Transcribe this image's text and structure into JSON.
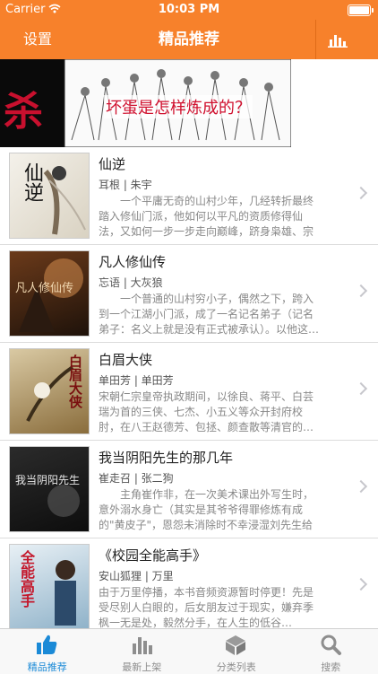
{
  "status_bar": {
    "carrier": "Carrier",
    "time": "10:03 PM"
  },
  "nav": {
    "settings_label": "设置",
    "title": "精品推荐"
  },
  "banner": {
    "caption": "坏蛋是怎样炼成的？",
    "overlay_text": "杀"
  },
  "books": [
    {
      "title": "仙逆",
      "author": "耳根 | 朱宇",
      "desc": "　　一个平庸无奇的山村少年，几经转折最终踏入修仙门派，他如何以平凡的资质修得仙法，又如何一步一步走向巅峰，跻身枭雄、宗师…",
      "cover_text": "仙逆"
    },
    {
      "title": "凡人修仙传",
      "author": "忘语 | 大灰狼",
      "desc": "　　一个普通的山村穷小子，偶然之下，跨入到一个江湖小门派，成了一名记名弟子（记名弟子：名义上就是没有正式被承认）。以他这…",
      "cover_text": "凡人修仙传"
    },
    {
      "title": "白眉大侠",
      "author": "单田芳 | 单田芳",
      "desc": "宋朝仁宗皇帝执政期间，以徐良、蒋平、白芸瑞为首的三侠、七杰、小五义等众开封府校肘，在八王赵德芳、包拯、颜查散等清官的…",
      "cover_text": "白眉大侠"
    },
    {
      "title": "我当阴阳先生的那几年",
      "author": "崔走召 | 张二狗",
      "desc": "　　主角崔作非，在一次美术课出外写生时，意外溺水身亡（其实是其爷爷得罪修炼有成的\"黄皮子\"，恩怨未消除时不幸浸湿刘先生给其的…",
      "cover_text": "我当阴阳先生"
    },
    {
      "title": "《校园全能高手》",
      "author": "安山狐狸 | 万里",
      "desc": "由于万里停播，本书音频资源暂时停更！先是受尽别人白眼的，后女朋友过于现实，嫌弃季枫一无是处，毅然分手，在人生的低谷…",
      "cover_text": "全能高手"
    }
  ],
  "tabs": [
    {
      "label": "精品推荐",
      "icon": "thumbs-up-icon",
      "active": true
    },
    {
      "label": "最新上架",
      "icon": "bar-chart-icon",
      "active": false
    },
    {
      "label": "分类列表",
      "icon": "box-icon",
      "active": false
    },
    {
      "label": "搜索",
      "icon": "search-icon",
      "active": false
    }
  ],
  "colors": {
    "accent": "#f7812b",
    "tab_active": "#1b8ad7",
    "tab_inactive": "#8e8e8e"
  }
}
